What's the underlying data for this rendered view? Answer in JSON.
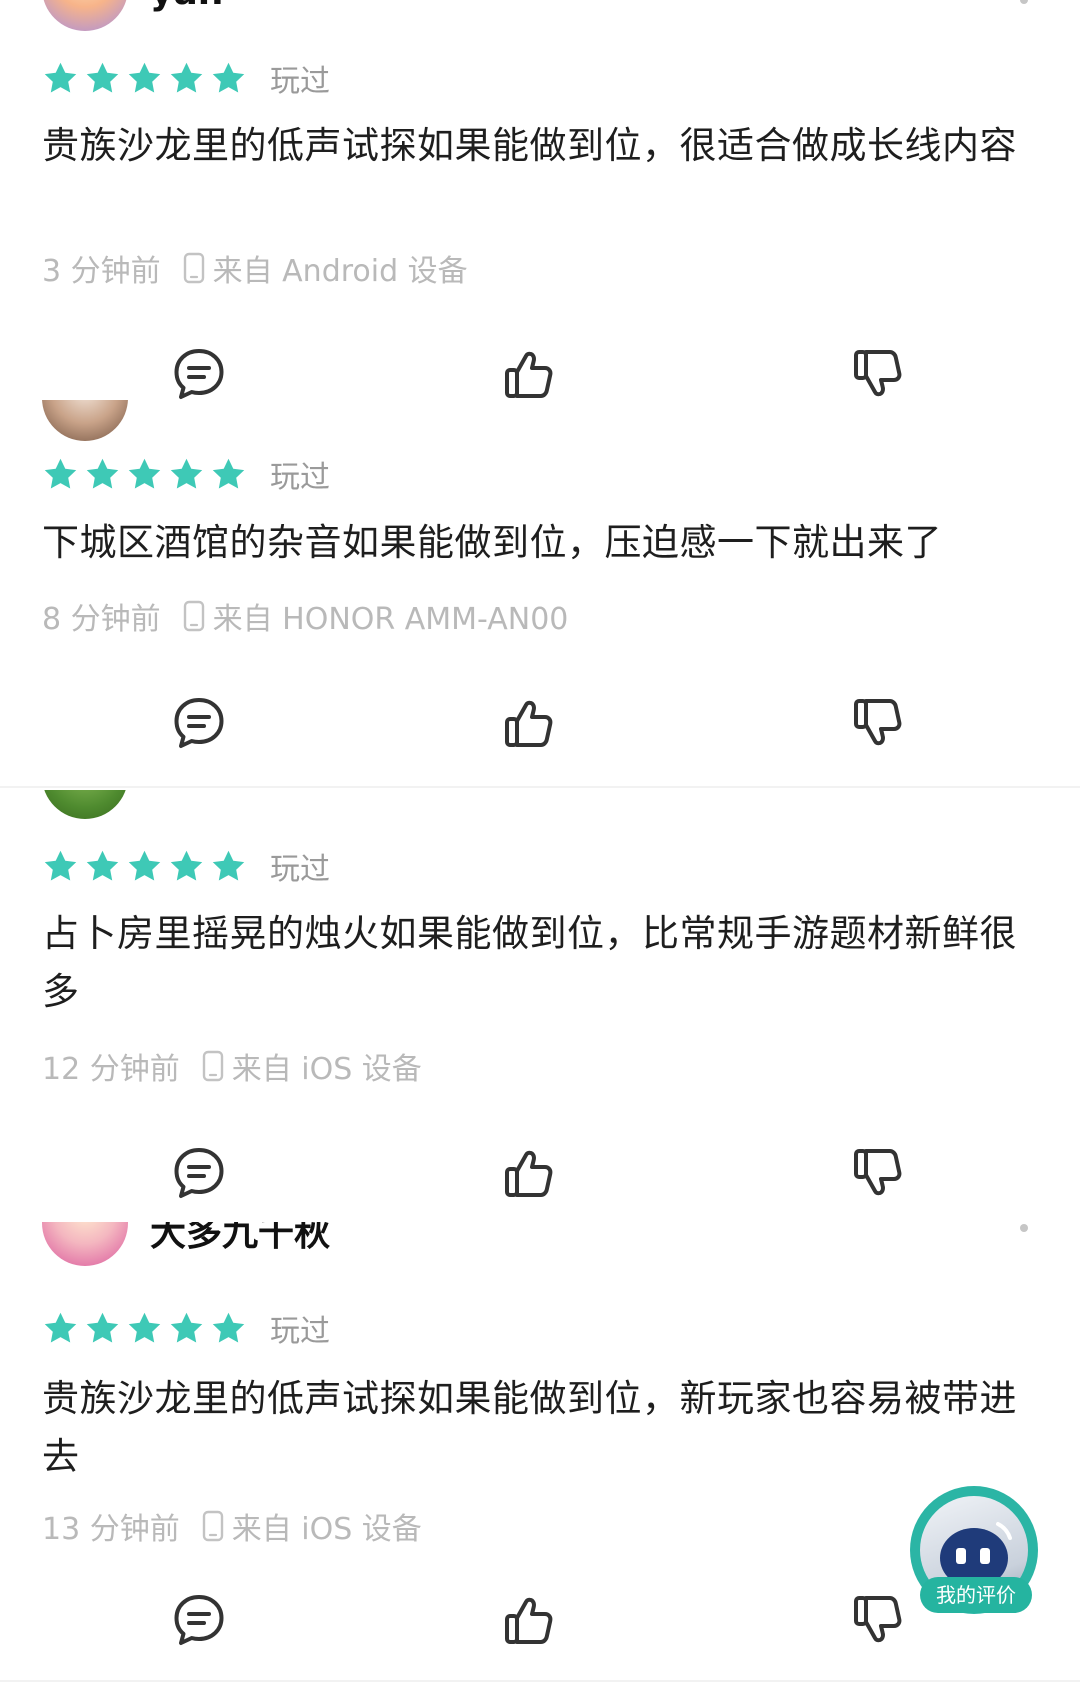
{
  "colors": {
    "star": "#3ec9b6",
    "meta_text": "#b9b9b9",
    "fab_accent": "#25b4a0"
  },
  "reviews": [
    {
      "username": "yan",
      "rating": 5,
      "status": "玩过",
      "content": "贵族沙龙里的低声试探如果能做到位，很适合做成长线内容",
      "time": "3 分钟前",
      "device": "来自 Android 设备"
    },
    {
      "username": "",
      "rating": 5,
      "status": "玩过",
      "content": "下城区酒馆的杂音如果能做到位，压迫感一下就出来了",
      "time": "8 分钟前",
      "device": "来自 HONOR AMM-AN00"
    },
    {
      "username": "",
      "rating": 5,
      "status": "玩过",
      "content": "占卜房里摇晃的烛火如果能做到位，比常规手游题材新鲜很多",
      "time": "12 分钟前",
      "device": "来自 iOS 设备"
    },
    {
      "username": "大多九千秋",
      "rating": 5,
      "status": "玩过",
      "content": "贵族沙龙里的低声试探如果能做到位，新玩家也容易被带进去",
      "time": "13 分钟前",
      "device": "来自 iOS 设备"
    }
  ],
  "fab": {
    "label": "我的评价"
  },
  "icons": {
    "comment": "comment-bubble-icon",
    "like": "thumbs-up-icon",
    "dislike": "thumbs-down-icon",
    "device": "phone-icon",
    "star": "star-icon",
    "more": "more-dot-icon"
  }
}
